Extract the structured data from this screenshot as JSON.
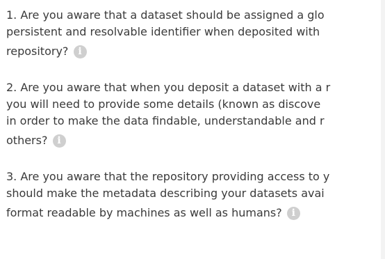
{
  "questions": [
    {
      "lines": [
        "1. Are you aware that a dataset should be assigned a glo",
        "persistent and resolvable identifier when deposited with",
        "repository?"
      ],
      "icon": "info-icon",
      "icon_glyph": "i"
    },
    {
      "lines": [
        "2. Are you aware that when you deposit a dataset with a r",
        "you will need to provide some details (known as discove",
        "in order to make the data findable, understandable and r",
        "others?"
      ],
      "icon": "info-icon",
      "icon_glyph": "i"
    },
    {
      "lines": [
        "3. Are you aware that the repository providing access to y",
        "should make the metadata describing your datasets avai",
        "format readable by machines as well as humans?"
      ],
      "icon": "info-icon",
      "icon_glyph": "i"
    }
  ],
  "colors": {
    "text": "#3a3a3a",
    "icon_bg": "#cfcfcf",
    "background": "#ffffff"
  }
}
